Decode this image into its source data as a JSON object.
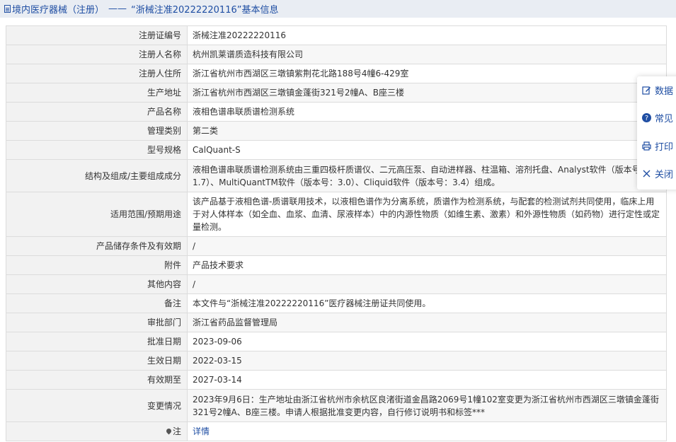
{
  "header": {
    "category": "境内医疗器械（注册）",
    "separator": "——",
    "title": "“浙械注准20222220116”基本信息"
  },
  "rows": [
    {
      "label": "注册证编号",
      "value": "浙械注准20222220116"
    },
    {
      "label": "注册人名称",
      "value": "杭州凯莱谱质造科技有限公司"
    },
    {
      "label": "注册人住所",
      "value": "浙江省杭州市西湖区三墩镇紫荆花北路188号4幢6-429室"
    },
    {
      "label": "生产地址",
      "value": "浙江省杭州市西湖区三墩镇金蓬街321号2幢A、B座三楼"
    },
    {
      "label": "产品名称",
      "value": "液相色谱串联质谱检测系统"
    },
    {
      "label": "管理类别",
      "value": "第二类"
    },
    {
      "label": "型号规格",
      "value": "CalQuant-S"
    },
    {
      "label": "结构及组成/主要组成成分",
      "value": "液相色谱串联质谱检测系统由三重四极杆质谱仪、二元高压泵、自动进样器、柱温箱、溶剂托盘、Analyst软件（版本号：1.7）、MultiQuantTM软件（版本号：3.0）、Cliquid软件（版本号：3.4）组成。"
    },
    {
      "label": "适用范围/预期用途",
      "value": "该产品基于液相色谱-质谱联用技术，以液相色谱作为分离系统，质谱作为检测系统，与配套的检测试剂共同使用，临床上用于对人体样本（如全血、血浆、血清、尿液样本）中的内源性物质（如维生素、激素）和外源性物质（如药物）进行定性或定量检测。"
    },
    {
      "label": "产品储存条件及有效期",
      "value": "/"
    },
    {
      "label": "附件",
      "value": "产品技术要求"
    },
    {
      "label": "其他内容",
      "value": "/"
    },
    {
      "label": "备注",
      "value": "本文件与“浙械注准20222220116”医疗器械注册证共同使用。"
    },
    {
      "label": "审批部门",
      "value": "浙江省药品监督管理局"
    },
    {
      "label": "批准日期",
      "value": "2023-09-06"
    },
    {
      "label": "生效日期",
      "value": "2022-03-15"
    },
    {
      "label": "有效期至",
      "value": "2027-03-14"
    },
    {
      "label": "变更情况",
      "value": "2023年9月6日：生产地址由浙江省杭州市余杭区良渚街道金昌路2069号1幢102室变更为浙江省杭州市西湖区三墩镇金蓬街321号2幢A、B座三楼。申请人根据批准变更内容，自行修订说明书和标签***"
    }
  ],
  "note": {
    "label": "注",
    "link": "详情"
  },
  "float_menu": {
    "data_error": "数据",
    "faq": "常见",
    "print": "打印",
    "close": "关闭"
  }
}
